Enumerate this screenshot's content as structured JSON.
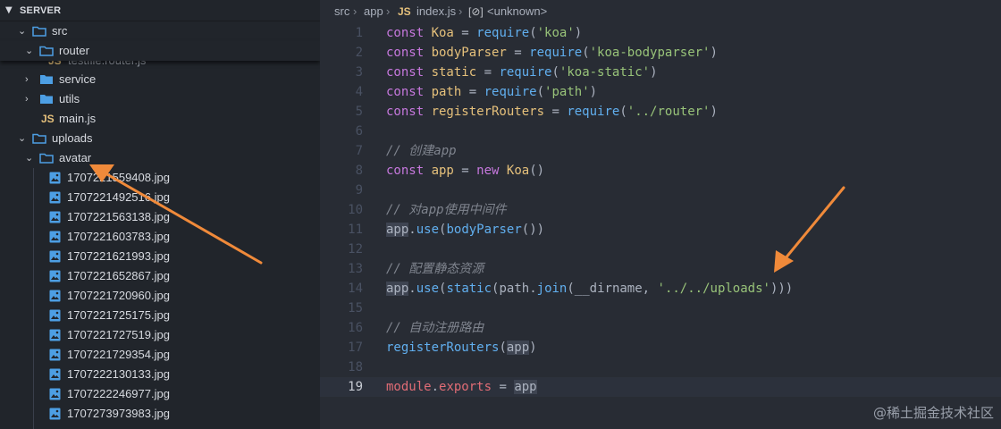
{
  "explorer": {
    "title": "SERVER",
    "tree": {
      "src": "src",
      "router": "router",
      "router_file_partial": "testfile.router.js",
      "service": "service",
      "utils": "utils",
      "js_badge": "JS",
      "main": "main.js",
      "uploads": "uploads",
      "avatar": "avatar",
      "files": [
        "1707221559408.jpg",
        "1707221492516.jpg",
        "1707221563138.jpg",
        "1707221603783.jpg",
        "1707221621993.jpg",
        "1707221652867.jpg",
        "1707221720960.jpg",
        "1707221725175.jpg",
        "1707221727519.jpg",
        "1707221729354.jpg",
        "1707222130133.jpg",
        "1707222246977.jpg",
        "1707273973983.jpg"
      ]
    }
  },
  "breadcrumb": {
    "seg1": "src",
    "seg2": "app",
    "js_badge": "JS",
    "file": "index.js",
    "symbol_icon": "[⊘]",
    "symbol": "<unknown>",
    "separator": "›"
  },
  "editor": {
    "current_line": 19,
    "lines": [
      {
        "n": "1",
        "t": [
          [
            "kw",
            "const "
          ],
          [
            "var",
            "Koa"
          ],
          [
            "plain",
            " = "
          ],
          [
            "fn",
            "require"
          ],
          [
            "plain",
            "("
          ],
          [
            "str",
            "'koa'"
          ],
          [
            "plain",
            ")"
          ]
        ]
      },
      {
        "n": "2",
        "t": [
          [
            "kw",
            "const "
          ],
          [
            "var",
            "bodyParser"
          ],
          [
            "plain",
            " = "
          ],
          [
            "fn",
            "require"
          ],
          [
            "plain",
            "("
          ],
          [
            "str",
            "'koa-bodyparser'"
          ],
          [
            "plain",
            ")"
          ]
        ]
      },
      {
        "n": "3",
        "t": [
          [
            "kw",
            "const "
          ],
          [
            "var",
            "static"
          ],
          [
            "plain",
            " = "
          ],
          [
            "fn",
            "require"
          ],
          [
            "plain",
            "("
          ],
          [
            "str",
            "'koa-static'"
          ],
          [
            "plain",
            ")"
          ]
        ]
      },
      {
        "n": "4",
        "t": [
          [
            "kw",
            "const "
          ],
          [
            "var",
            "path"
          ],
          [
            "plain",
            " = "
          ],
          [
            "fn",
            "require"
          ],
          [
            "plain",
            "("
          ],
          [
            "str",
            "'path'"
          ],
          [
            "plain",
            ")"
          ]
        ]
      },
      {
        "n": "5",
        "t": [
          [
            "kw",
            "const "
          ],
          [
            "var",
            "registerRouters"
          ],
          [
            "plain",
            " = "
          ],
          [
            "fn",
            "require"
          ],
          [
            "plain",
            "("
          ],
          [
            "str",
            "'../router'"
          ],
          [
            "plain",
            ")"
          ]
        ]
      },
      {
        "n": "6",
        "t": []
      },
      {
        "n": "7",
        "t": [
          [
            "cmt",
            "// 创建app"
          ]
        ]
      },
      {
        "n": "8",
        "t": [
          [
            "kw",
            "const "
          ],
          [
            "var",
            "app"
          ],
          [
            "plain",
            " = "
          ],
          [
            "kw",
            "new "
          ],
          [
            "var",
            "Koa"
          ],
          [
            "plain",
            "()"
          ]
        ]
      },
      {
        "n": "9",
        "t": []
      },
      {
        "n": "10",
        "t": [
          [
            "cmt",
            "// 对app使用中间件"
          ]
        ]
      },
      {
        "n": "11",
        "t": [
          [
            "hl",
            "app"
          ],
          [
            "plain",
            "."
          ],
          [
            "fn",
            "use"
          ],
          [
            "plain",
            "("
          ],
          [
            "fn",
            "bodyParser"
          ],
          [
            "plain",
            "())"
          ]
        ]
      },
      {
        "n": "12",
        "t": []
      },
      {
        "n": "13",
        "t": [
          [
            "cmt",
            "// 配置静态资源"
          ]
        ]
      },
      {
        "n": "14",
        "t": [
          [
            "hl",
            "app"
          ],
          [
            "plain",
            "."
          ],
          [
            "fn",
            "use"
          ],
          [
            "plain",
            "("
          ],
          [
            "fn",
            "static"
          ],
          [
            "plain",
            "("
          ],
          [
            "plain",
            "path"
          ],
          [
            "plain",
            "."
          ],
          [
            "fn",
            "join"
          ],
          [
            "plain",
            "("
          ],
          [
            "plain",
            "__dirname"
          ],
          [
            "plain",
            ", "
          ],
          [
            "str",
            "'../../uploads'"
          ],
          [
            "plain",
            ")))"
          ]
        ]
      },
      {
        "n": "15",
        "t": []
      },
      {
        "n": "16",
        "t": [
          [
            "cmt",
            "// 自动注册路由"
          ]
        ]
      },
      {
        "n": "17",
        "t": [
          [
            "fn",
            "registerRouters"
          ],
          [
            "plain",
            "("
          ],
          [
            "hl",
            "app"
          ],
          [
            "plain",
            ")"
          ]
        ]
      },
      {
        "n": "18",
        "t": []
      },
      {
        "n": "19",
        "t": [
          [
            "prop",
            "module"
          ],
          [
            "plain",
            "."
          ],
          [
            "prop",
            "exports"
          ],
          [
            "plain",
            " = "
          ],
          [
            "hl",
            "app"
          ]
        ]
      }
    ]
  },
  "watermark": "@稀土掘金技术社区",
  "colors": {
    "sidebar_bg": "#21252b",
    "editor_bg": "#282c34",
    "folder_blue": "#4d9fe4",
    "annotation_arrow": "#f08a3a"
  }
}
